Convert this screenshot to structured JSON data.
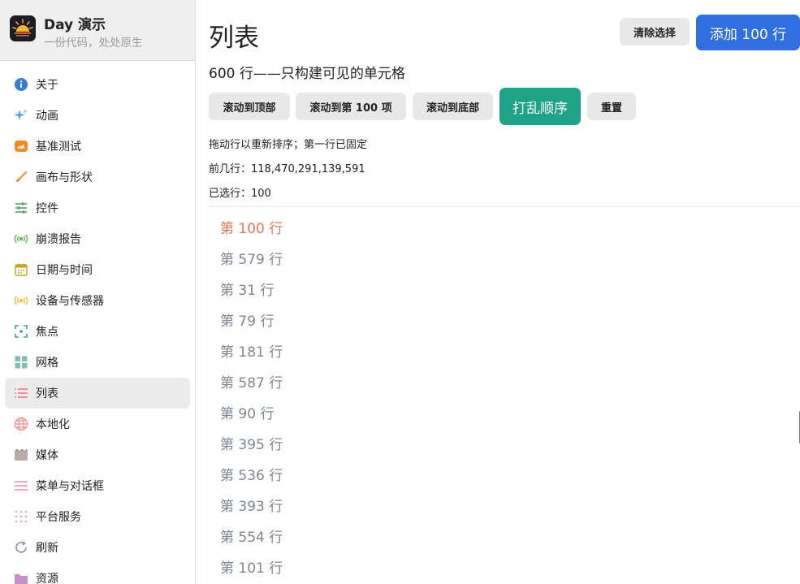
{
  "app": {
    "title": "Day 演示",
    "subtitle": "一份代码，处处原生"
  },
  "sidebar": {
    "items": [
      {
        "label": "关于",
        "icon": "info-icon"
      },
      {
        "label": "动画",
        "icon": "sparkle-icon"
      },
      {
        "label": "基准测试",
        "icon": "speedometer-icon"
      },
      {
        "label": "画布与形状",
        "icon": "paintbrush-icon"
      },
      {
        "label": "控件",
        "icon": "sliders-icon"
      },
      {
        "label": "崩溃报告",
        "icon": "broadcast-icon"
      },
      {
        "label": "日期与时间",
        "icon": "calendar-icon"
      },
      {
        "label": "设备与传感器",
        "icon": "sensor-icon"
      },
      {
        "label": "焦点",
        "icon": "focus-icon"
      },
      {
        "label": "网格",
        "icon": "grid-icon"
      },
      {
        "label": "列表",
        "icon": "list-icon"
      },
      {
        "label": "本地化",
        "icon": "globe-icon"
      },
      {
        "label": "媒体",
        "icon": "clapperboard-icon"
      },
      {
        "label": "菜单与对话框",
        "icon": "menu-icon"
      },
      {
        "label": "平台服务",
        "icon": "dots-grid-icon"
      },
      {
        "label": "刷新",
        "icon": "refresh-icon"
      },
      {
        "label": "资源",
        "icon": "folder-icon"
      }
    ],
    "active_index": 10
  },
  "main": {
    "title": "列表",
    "clear_selection_label": "清除选择",
    "add_rows_label": "添加 100 行",
    "subtitle": "600 行——只构建可见的单元格",
    "toolbar": {
      "scroll_top": "滚动到顶部",
      "scroll_100": "滚动到第 100 项",
      "scroll_bottom": "滚动到底部",
      "shuffle": "打乱顺序",
      "reset": "重置"
    },
    "drag_hint": "拖动行以重新排序；第一行已固定",
    "first_rows_label": "前几行：",
    "first_rows_value": "118,470,291,139,591",
    "selected_label": "已选行：",
    "selected_value": "100",
    "rows": [
      {
        "label": "第 100 行",
        "selected": true
      },
      {
        "label": "第 579 行",
        "selected": false
      },
      {
        "label": "第 31 行",
        "selected": false
      },
      {
        "label": "第 79 行",
        "selected": false
      },
      {
        "label": "第 181 行",
        "selected": false
      },
      {
        "label": "第 587 行",
        "selected": false
      },
      {
        "label": "第 90 行",
        "selected": false
      },
      {
        "label": "第 395 行",
        "selected": false
      },
      {
        "label": "第 536 行",
        "selected": false
      },
      {
        "label": "第 393 行",
        "selected": false
      },
      {
        "label": "第 554 行",
        "selected": false
      },
      {
        "label": "第 101 行",
        "selected": false
      }
    ]
  },
  "colors": {
    "accent_blue": "#2f6fe0",
    "accent_teal": "#1ea387",
    "selected_row": "#e07a5a",
    "row_text": "#7d8793"
  }
}
